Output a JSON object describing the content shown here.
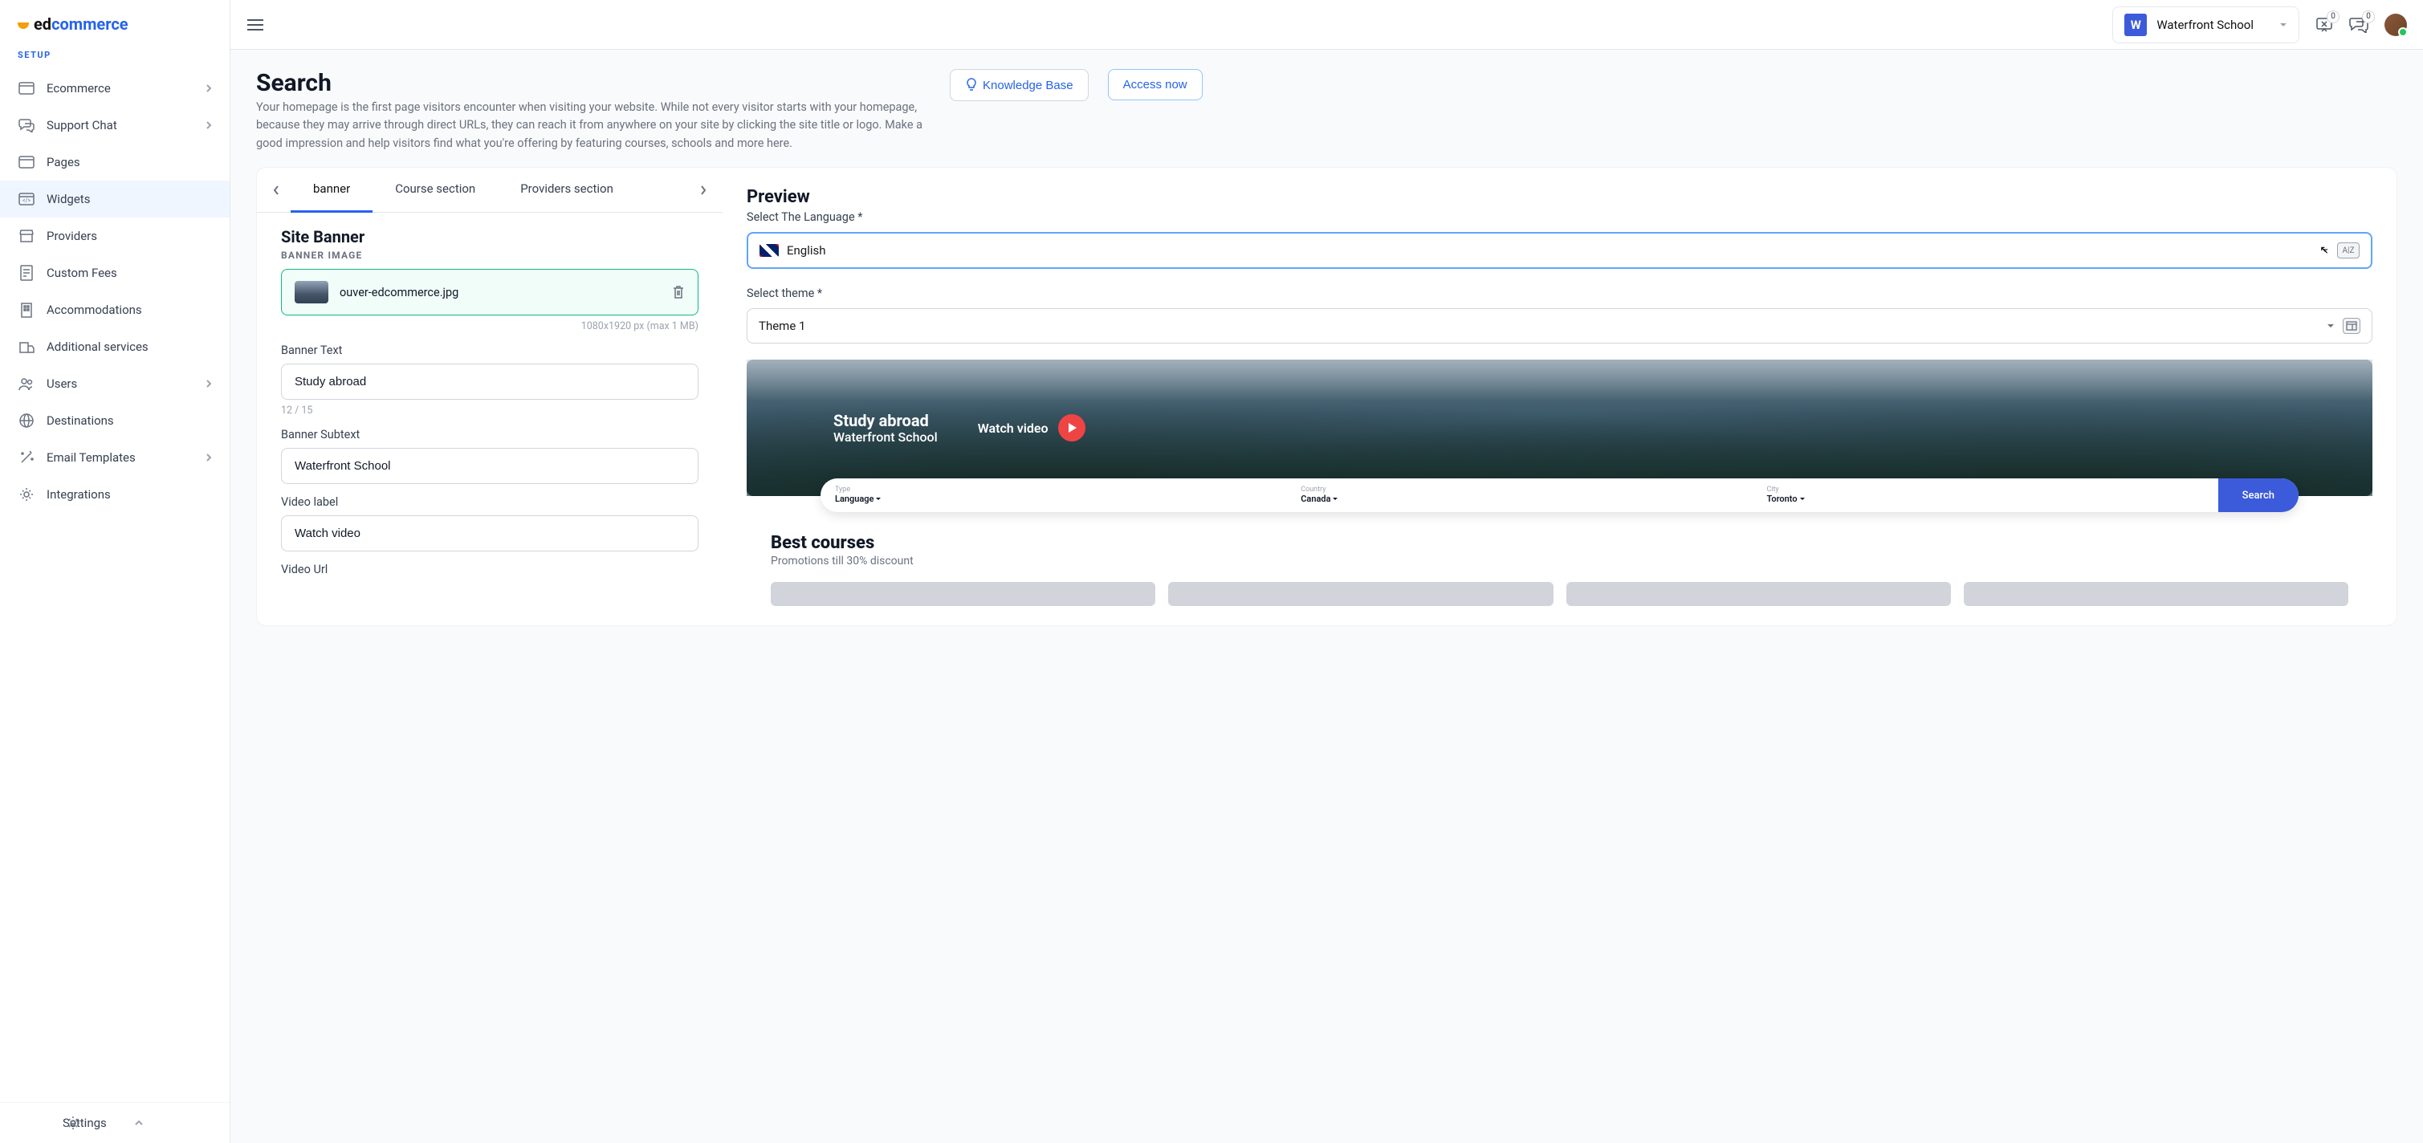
{
  "brand": {
    "prefix": "ed",
    "suffix": "commerce"
  },
  "sidebar": {
    "section": "SETUP",
    "items": [
      {
        "label": "Ecommerce",
        "chevron": true
      },
      {
        "label": "Support Chat",
        "chevron": true
      },
      {
        "label": "Pages",
        "chevron": false
      },
      {
        "label": "Widgets",
        "chevron": false
      },
      {
        "label": "Providers",
        "chevron": false
      },
      {
        "label": "Custom Fees",
        "chevron": false
      },
      {
        "label": "Accommodations",
        "chevron": false
      },
      {
        "label": "Additional services",
        "chevron": false
      },
      {
        "label": "Users",
        "chevron": true
      },
      {
        "label": "Destinations",
        "chevron": false
      },
      {
        "label": "Email Templates",
        "chevron": true
      },
      {
        "label": "Integrations",
        "chevron": false
      }
    ],
    "settings": "Settings"
  },
  "topbar": {
    "school_initial": "W",
    "school_name": "Waterfront School",
    "badge1": "0",
    "badge2": "0"
  },
  "page": {
    "title": "Search",
    "description": "Your homepage is the first page visitors encounter when visiting your website. While not every visitor starts with your homepage, because they may arrive through direct URLs, they can reach it from anywhere on your site by clicking the site title or logo. Make a good impression and help visitors find what you're offering by featuring courses, schools and more here.",
    "knowledge_btn": "Knowledge Base",
    "access_btn": "Access now"
  },
  "tabs": [
    "banner",
    "Course section",
    "Providers section"
  ],
  "form": {
    "section_title": "Site Banner",
    "image_label": "BANNER IMAGE",
    "file_name": "ouver-edcommerce.jpg",
    "image_hint": "1080x1920 px (max 1 MB)",
    "banner_text_label": "Banner Text",
    "banner_text_value": "Study abroad",
    "banner_text_counter": "12 / 15",
    "banner_subtext_label": "Banner Subtext",
    "banner_subtext_value": "Waterfront School",
    "video_label_label": "Video label",
    "video_label_value": "Watch video",
    "video_url_label": "Video Url"
  },
  "preview": {
    "title": "Preview",
    "lang_label": "Select The Language *",
    "lang_value": "English",
    "theme_label": "Select theme *",
    "theme_value": "Theme 1",
    "banner_heading": "Study abroad",
    "banner_sub": "Waterfront School",
    "watch_label": "Watch video",
    "pill": {
      "type_label": "Type",
      "type_value": "Language",
      "country_label": "Country",
      "country_value": "Canada",
      "city_label": "City",
      "city_value": "Toronto",
      "search": "Search"
    },
    "best_h": "Best courses",
    "best_sub": "Promotions till 30% discount"
  }
}
